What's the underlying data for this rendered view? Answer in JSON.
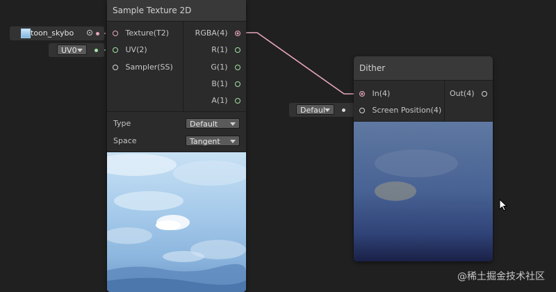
{
  "sample_texture_node": {
    "title": "Sample Texture 2D",
    "inputs": [
      {
        "label": "Texture(T2)",
        "color": "#e6a6bd"
      },
      {
        "label": "UV(2)",
        "color": "#a3e2a4"
      },
      {
        "label": "Sampler(SS)",
        "color": "#d8d8d8"
      }
    ],
    "outputs": [
      {
        "label": "RGBA(4)",
        "color": "#e6a6bd"
      },
      {
        "label": "R(1)",
        "color": "#a3e2a4"
      },
      {
        "label": "G(1)",
        "color": "#a3e2a4"
      },
      {
        "label": "B(1)",
        "color": "#a3e2a4"
      },
      {
        "label": "A(1)",
        "color": "#a3e2a4"
      }
    ],
    "type_label": "Type",
    "type_value": "Default",
    "space_label": "Space",
    "space_value": "Tangent"
  },
  "texture_field": {
    "value": "toon_skybo"
  },
  "uv_field": {
    "value": "UV0"
  },
  "dither_node": {
    "title": "Dither",
    "inputs": [
      {
        "label": "In(4)",
        "color": "#e6a6bd"
      },
      {
        "label": "Screen Position(4)",
        "color": "#d8d8d8"
      }
    ],
    "output": {
      "label": "Out(4)",
      "color": "#d8d8d8"
    }
  },
  "screen_position_field": {
    "value": "Defaul"
  },
  "watermark": "@稀土掘金技术社区",
  "colors": {
    "canvas": "#202020",
    "node_body": "#2b2b2b",
    "node_header": "#393939",
    "wire": "#e6a6bd",
    "vector4_port": "#e6a6bd",
    "float_port": "#a3e2a4"
  }
}
